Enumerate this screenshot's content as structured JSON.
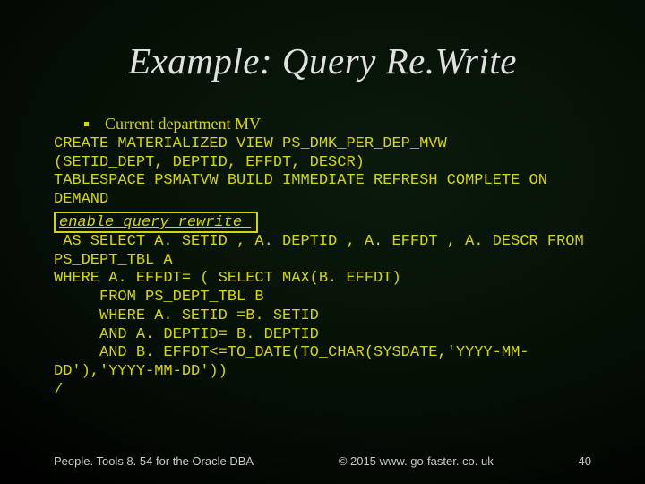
{
  "title": "Example: Query Re.Write",
  "bullet": "Current department MV",
  "code1": "CREATE MATERIALIZED VIEW PS_DMK_PER_DEP_MVW\n(SETID_DEPT, DEPTID, EFFDT, DESCR)\nTABLESPACE PSMATVW BUILD IMMEDIATE REFRESH COMPLETE ON\nDEMAND",
  "highlight": "enable query rewrite ",
  "code2": " AS SELECT A. SETID , A. DEPTID , A. EFFDT , A. DESCR FROM\nPS_DEPT_TBL A\nWHERE A. EFFDT= ( SELECT MAX(B. EFFDT)\n     FROM PS_DEPT_TBL B\n     WHERE A. SETID =B. SETID\n     AND A. DEPTID= B. DEPTID\n     AND B. EFFDT<=TO_DATE(TO_CHAR(SYSDATE,'YYYY-MM-\nDD'),'YYYY-MM-DD'))\n/",
  "footer": {
    "left": "People. Tools 8. 54 for the Oracle DBA",
    "center": "© 2015 www. go-faster. co. uk",
    "right": "40"
  }
}
